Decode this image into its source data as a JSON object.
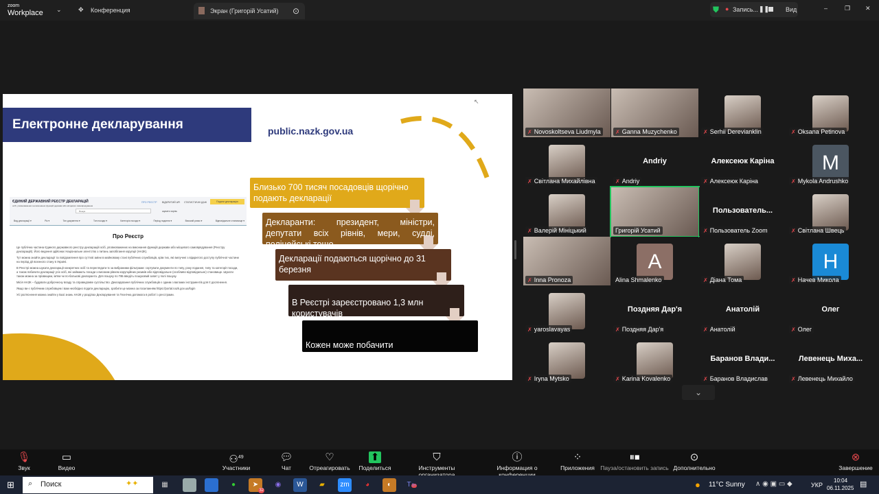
{
  "topbar": {
    "app_brand_top": "zoom",
    "app_brand": "Workplace",
    "meeting_label": "Конференция",
    "share_tab": "Экран (Григорій Усатий)",
    "recording": "Запись...",
    "view": "Вид"
  },
  "slide": {
    "title": "Електронне декларування",
    "url": "public.nazk.gov.ua",
    "boxes": [
      "Близько 700 тисяч посадовців щорічно подають декларації",
      "Декларанти: президент, міністри, депутати всіх рівнів, мери, судді, поліцейські тощо",
      "Декларації подаються щорічно до 31 березня",
      "В Реєстрі зареєстровано 1,3 млн користувачів",
      "Кожен може побачити"
    ],
    "box_colors": [
      "#e0a91a",
      "#8b5a1e",
      "#5a3420",
      "#2e1f1a",
      "#050505"
    ],
    "register": {
      "title": "ЄДИНИЙ ДЕРЖАВНИЙ РЕЄСТР ДЕКЛАРАЦІЙ",
      "subtitle": "осіб, уповноважених на виконання функцій держави або місцевого самоврядування",
      "nav": [
        "ПРО РЕЄСТР",
        "ВІДКРИТИЙ API",
        "СТАТИСТИЧНІ ДАНІ"
      ],
      "submit": "Подати декларацію",
      "search_placeholder": "Пошук",
      "checkbox": "шукати скрізь",
      "filters": [
        "Вид декларації ▾",
        "Рік ▾",
        "Тип документа ▾",
        "Тип посади ▾",
        "Категорія посади ▾",
        "Період подання ▾",
        "Високий ризик ▾",
        "Відповідальне становище ▾"
      ],
      "heading": "Про Реєстр",
      "paragraphs": [
        "Це публічна частина Єдиного державного реєстру декларацій осіб, уповноважених на виконання функцій держави або місцевого самоврядування (Реєстру декларацій). Його ведення здійснює Національне агентство з питань запобігання корупції (НАЗК).",
        "Тут можна знайти декларації та повідомлення про суттєві зміни в майновому стані публічних службовців, крім тих, які вилучені з відкритого доступу публічної частини на період дії воєнного стану в Україні.",
        "В Реєстрі можна шукати декларації конкретних осіб та переглядати їх за вибраними фільтрами: сортувати документи по типу, року подання, типу та категорії посади, а також побачити декларації усіх осіб, які займають посади з високим рівнем корупційних ризиків або відповідальне (особливо відповідальне) становище. Шукати також можна за прізвищем, ім'ям чи по-батькові декларанта. Для пошуку по ПІБ введіть пошуковий запит у полі пошуку.",
        "Місія НАЗК – будувати доброчесну владу та справедливе суспільство. Декларування публічних службовців є одним з вагомих інструментів для її досягнення.",
        "Якщо ви є публічним службовцем і вам необхідно подати декларацію, зробити це можна за посиланням https://portal.nazk.gov.ua/login",
        "Усі роз'яснення можна знайти у Базі знань НАЗК у розділах Декларування та Технічна допомога в роботі з реєстрами."
      ]
    }
  },
  "participants": [
    {
      "name": "Novoskoltseva Liudmyla",
      "type": "video",
      "muted": true
    },
    {
      "name": "Ganna Muzychenko",
      "type": "video",
      "muted": true
    },
    {
      "name": "Serhii Derevianklin",
      "type": "photo",
      "muted": true
    },
    {
      "name": "Oksana Petinova",
      "type": "photo",
      "muted": true
    },
    {
      "name": "Світлана Михайлівна",
      "type": "photo",
      "muted": true
    },
    {
      "name": "Andriy",
      "type": "name",
      "big": "Andriy",
      "muted": true
    },
    {
      "name": "Алексеюк Каріна",
      "type": "name",
      "big": "Алексеюк Каріна",
      "muted": true
    },
    {
      "name": "Mykola Andrushko",
      "type": "letter",
      "letter": "M",
      "color": "#4b5661",
      "muted": true
    },
    {
      "name": "Валерій Мініцький",
      "type": "photo",
      "muted": true
    },
    {
      "name": "Григорій Усатий",
      "type": "video",
      "muted": false,
      "active": true
    },
    {
      "name": "Пользователь Zoom",
      "type": "name",
      "big": "Пользователь...",
      "muted": true
    },
    {
      "name": "Світлана Швець",
      "type": "photo",
      "muted": true
    },
    {
      "name": "Inna Pronoza",
      "type": "video",
      "muted": true
    },
    {
      "name": "Alina Shmalenko",
      "type": "letter",
      "letter": "A",
      "color": "#8c6f66",
      "muted": false
    },
    {
      "name": "Діана  Тома",
      "type": "photo",
      "muted": true
    },
    {
      "name": "Начев Микола",
      "type": "letter",
      "letter": "H",
      "color": "#1a8ad6",
      "muted": true
    },
    {
      "name": "yaroslavayas",
      "type": "photo",
      "muted": true
    },
    {
      "name": "Поздняя Дар'я",
      "type": "name",
      "big": "Поздняя Дар'я",
      "muted": true
    },
    {
      "name": "Анатолій",
      "type": "name",
      "big": "Анатолій",
      "muted": true
    },
    {
      "name": "Олег",
      "type": "name",
      "big": "Олег",
      "muted": true
    },
    {
      "name": "Iryna Mytsko",
      "type": "photo",
      "muted": true
    },
    {
      "name": "Karina Kovalenko",
      "type": "photo",
      "muted": true
    },
    {
      "name": "Баранов Владислав",
      "type": "name",
      "big": "Баранов  Влади...",
      "muted": true
    },
    {
      "name": "Левенець Михайло",
      "type": "name",
      "big": "Левенець  Миха...",
      "muted": true
    }
  ],
  "toolbar": {
    "audio": "Звук",
    "video": "Видео",
    "participants": "Участники",
    "participants_count": "49",
    "chat": "Чат",
    "react": "Отреагировать",
    "share": "Поделиться",
    "host_tools": "Инструменты организатора",
    "meeting_info": "Информация о конференции",
    "apps": "Приложения",
    "pause_rec": "Пауза/остановить запись",
    "more": "Дополнительно",
    "end": "Завершение"
  },
  "taskbar": {
    "search": "Поиск",
    "weather": "11°C  Sunny",
    "lang": "УКР",
    "time": "10:04",
    "date": "06.11.2025",
    "telegram_badge": "32",
    "teams_badge": "9+"
  }
}
